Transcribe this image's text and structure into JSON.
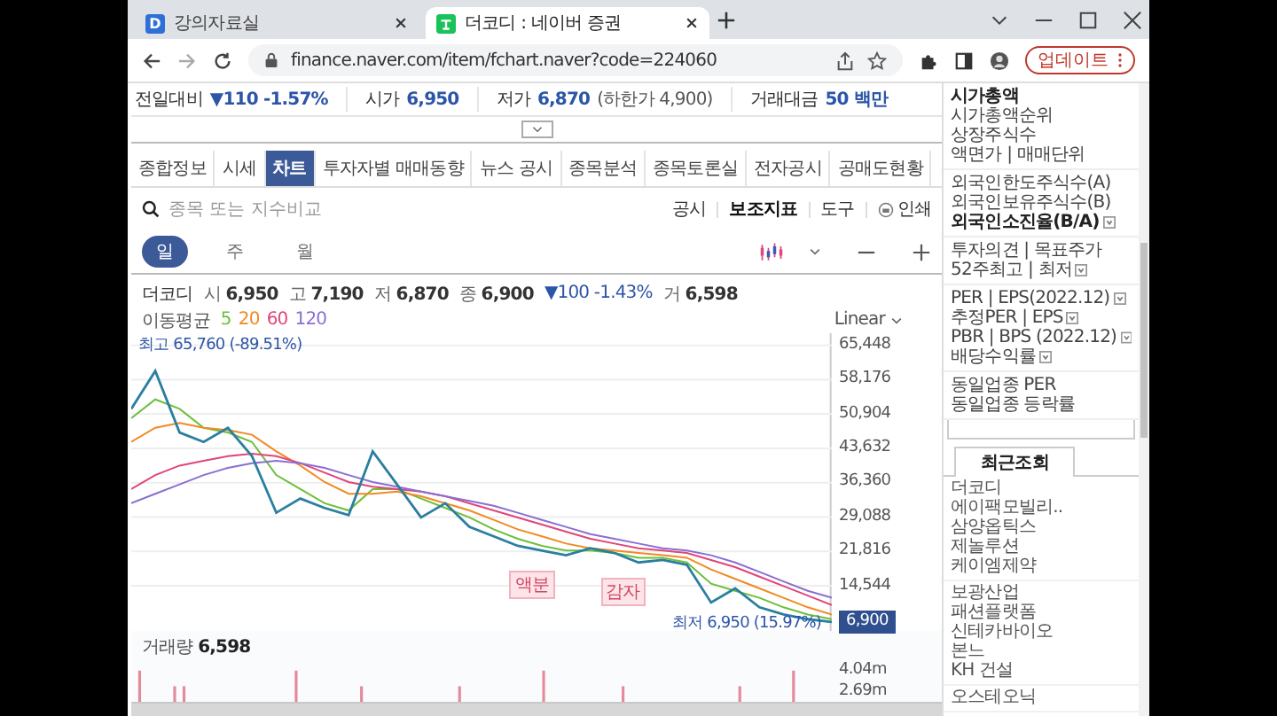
{
  "browser": {
    "tabs": [
      {
        "title": "강의자료실",
        "favicon_letter": "D",
        "selected": false
      },
      {
        "title": "더코디 : 네이버 증권",
        "selected": true
      }
    ],
    "url": "finance.naver.com/item/fchart.naver?code=224060",
    "update_button": "업데이트"
  },
  "summary": [
    {
      "label": "전일대비",
      "value": "▼110 -1.57%"
    },
    {
      "label": "시가",
      "value": "6,950"
    },
    {
      "label": "저가",
      "value": "6,870",
      "note": "(하한가 4,900)"
    },
    {
      "label": "거래대금",
      "value": "50 백만"
    }
  ],
  "nav_tabs": [
    {
      "label": "종합정보",
      "selected": false
    },
    {
      "label": "시세",
      "selected": false
    },
    {
      "label": "차트",
      "selected": true
    },
    {
      "label": "투자자별 매매동향",
      "selected": false
    },
    {
      "label": "뉴스 공시",
      "selected": false
    },
    {
      "label": "종목분석",
      "selected": false
    },
    {
      "label": "종목토론실",
      "selected": false
    },
    {
      "label": "전자공시",
      "selected": false
    },
    {
      "label": "공매도현황",
      "selected": false
    }
  ],
  "search": {
    "placeholder": "종목 또는 지수비교"
  },
  "tools": [
    {
      "label": "공시",
      "kind": "text",
      "selected": false
    },
    {
      "label": "보조지표",
      "kind": "text",
      "selected": true
    },
    {
      "label": "도구",
      "kind": "text",
      "selected": false
    },
    {
      "label": "인쇄",
      "kind": "print",
      "selected": false
    }
  ],
  "periods": [
    {
      "label": "일",
      "selected": true
    },
    {
      "label": "주",
      "selected": false
    },
    {
      "label": "월",
      "selected": false
    }
  ],
  "quote_line": {
    "name": "더코디",
    "fields": [
      {
        "kind": "field",
        "label": "시",
        "value": "6,950"
      },
      {
        "kind": "field",
        "label": "고",
        "value": "7,190"
      },
      {
        "kind": "field",
        "label": "저",
        "value": "6,870"
      },
      {
        "kind": "field",
        "label": "종",
        "value": "6,900"
      },
      {
        "kind": "change",
        "value": "▼100 -1.43%"
      },
      {
        "kind": "field",
        "label": "거",
        "value": "6,598"
      }
    ]
  },
  "moving_average": {
    "label": "이동평균"
  },
  "scale_select": "Linear",
  "chart": {
    "high_marker": "최고 65,760 (-89.51%)",
    "low_marker": "최저 6,950 (15.97%)",
    "events": [
      "액분",
      "감자"
    ],
    "current_price": "6,900",
    "chart_data": {
      "type": "line",
      "ylim": [
        5000,
        68000
      ],
      "grid": true,
      "yticks": [
        {
          "value": 65448,
          "label": "65,448"
        },
        {
          "value": 58176,
          "label": "58,176"
        },
        {
          "value": 50904,
          "label": "50,904"
        },
        {
          "value": 43632,
          "label": "43,632"
        },
        {
          "value": 36360,
          "label": "36,360"
        },
        {
          "value": 29088,
          "label": "29,088"
        },
        {
          "value": 21816,
          "label": "21,816"
        },
        {
          "value": 14544,
          "label": "14,544"
        }
      ],
      "series": [
        {
          "name": "5",
          "color": "#6cbf3a",
          "values": [
            50000,
            54000,
            52000,
            48000,
            47000,
            45000,
            38000,
            35000,
            32000,
            30500,
            35000,
            35000,
            33000,
            31000,
            29000,
            26500,
            24500,
            23000,
            22000,
            22000,
            21500,
            20500,
            20500,
            19500,
            15000,
            13500,
            12000,
            10000,
            8500,
            7500
          ]
        },
        {
          "name": "20",
          "color": "#f08a24",
          "values": [
            45000,
            48000,
            49000,
            48000,
            47500,
            46500,
            43000,
            40000,
            36500,
            34000,
            34000,
            34500,
            33500,
            32000,
            30500,
            28500,
            26500,
            25000,
            23500,
            22500,
            22000,
            21500,
            21000,
            20500,
            18000,
            16000,
            14000,
            12000,
            10000,
            8500
          ]
        },
        {
          "name": "60",
          "color": "#e0457b",
          "values": [
            35000,
            38000,
            40000,
            41000,
            42000,
            42500,
            42000,
            40500,
            38500,
            36500,
            35500,
            35000,
            34500,
            33500,
            32000,
            30500,
            29000,
            27500,
            26000,
            24500,
            23500,
            22500,
            22000,
            21500,
            20000,
            18500,
            16500,
            14500,
            12500,
            10500
          ]
        },
        {
          "name": "120",
          "color": "#8a6fd1",
          "values": [
            32000,
            34000,
            36000,
            38000,
            39500,
            40500,
            41000,
            40500,
            39500,
            38000,
            36500,
            35500,
            34500,
            33500,
            32500,
            31500,
            30000,
            28500,
            27000,
            25500,
            24500,
            23500,
            22500,
            22000,
            21000,
            19500,
            17500,
            15500,
            13500,
            12000
          ]
        },
        {
          "color": "#2a7fa0",
          "values": [
            52000,
            60000,
            47000,
            45000,
            48000,
            42000,
            30000,
            33000,
            31000,
            29500,
            43000,
            36000,
            29000,
            32000,
            27000,
            25000,
            23000,
            22000,
            21000,
            22500,
            21500,
            19500,
            20000,
            19000,
            11000,
            14000,
            10000,
            8500,
            7500,
            6900
          ]
        }
      ]
    }
  },
  "volume": {
    "label": "거래량",
    "value": "6,598",
    "y_labels": [
      "4.04m",
      "2.69m"
    ]
  },
  "sidebar": {
    "groups": [
      [
        {
          "text": "시가총액",
          "bold": true,
          "info": false
        },
        {
          "text": "시가총액순위",
          "bold": false,
          "info": false
        },
        {
          "text": "상장주식수",
          "bold": false,
          "info": false
        },
        {
          "text": "액면가 | 매매단위",
          "bold": false,
          "info": false
        }
      ],
      [
        {
          "text": "외국인한도주식수(A)",
          "bold": false,
          "info": false
        },
        {
          "text": "외국인보유주식수(B)",
          "bold": false,
          "info": false
        },
        {
          "text": "외국인소진율(B/A)",
          "bold": true,
          "info": true
        }
      ],
      [
        {
          "text": "투자의견 | 목표주가",
          "bold": false,
          "info": false
        },
        {
          "text": "52주최고 | 최저",
          "bold": false,
          "info": true
        }
      ],
      [
        {
          "text": "PER | EPS(2022.12)",
          "bold": false,
          "info": true
        },
        {
          "text": "추정PER | EPS",
          "bold": false,
          "info": true
        },
        {
          "text": "PBR | BPS (2022.12)",
          "bold": false,
          "info": true
        },
        {
          "text": "배당수익률",
          "bold": false,
          "info": true
        }
      ],
      [
        {
          "text": "동일업종 PER",
          "bold": false,
          "info": false
        },
        {
          "text": "동일업종 등락률",
          "bold": false,
          "info": false
        }
      ]
    ],
    "recent_tab": "최근조회",
    "recent_groups": [
      [
        "더코디",
        "에이팩모빌리..",
        "삼양옵틱스",
        "제놀루션",
        "케이엠제약"
      ],
      [
        "보광산업",
        "패션플랫폼",
        "신테카바이오",
        "본느",
        "KH 건설"
      ],
      [
        "오스테오닉"
      ]
    ]
  }
}
